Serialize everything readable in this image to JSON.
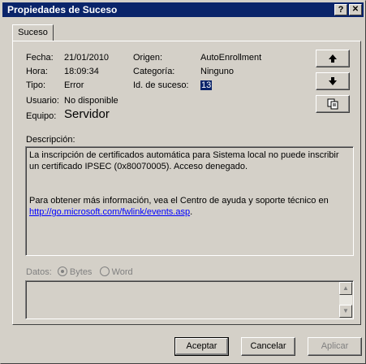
{
  "window": {
    "title": "Propiedades de Suceso"
  },
  "titlebar_buttons": {
    "help": "?",
    "close": "✕"
  },
  "tabs": [
    {
      "label": "Suceso"
    }
  ],
  "fields": {
    "fecha_label": "Fecha:",
    "fecha_value": "21/01/2010",
    "hora_label": "Hora:",
    "hora_value": "18:09:34",
    "tipo_label": "Tipo:",
    "tipo_value": "Error",
    "usuario_label": "Usuario:",
    "usuario_value": "No disponible",
    "equipo_label": "Equipo:",
    "equipo_value": "Servidor",
    "origen_label": "Origen:",
    "origen_value": "AutoEnrollment",
    "categoria_label": "Categoría:",
    "categoria_value": "Ninguno",
    "id_label": "Id. de suceso:",
    "id_value": "13"
  },
  "side_buttons": {
    "up": "↑",
    "down": "↓",
    "copy": "copy-icon"
  },
  "description": {
    "label": "Descripción:",
    "line1": "La inscripción de certificados automática para Sistema local no puede inscribir un certificado IPSEC (0x80070005). Acceso denegado.",
    "line2": "Para obtener más información, vea el Centro de ayuda y soporte técnico en",
    "link": "http://go.microsoft.com/fwlink/events.asp",
    "link_suffix": "."
  },
  "data_section": {
    "label": "Datos:",
    "option_bytes": "Bytes",
    "option_word": "Word",
    "selected": "Bytes"
  },
  "footer": {
    "accept": "Aceptar",
    "cancel": "Cancelar",
    "apply": "Aplicar"
  },
  "colors": {
    "titlebar": "#0a246a",
    "face": "#d4d0c8",
    "link": "#0000ff"
  }
}
